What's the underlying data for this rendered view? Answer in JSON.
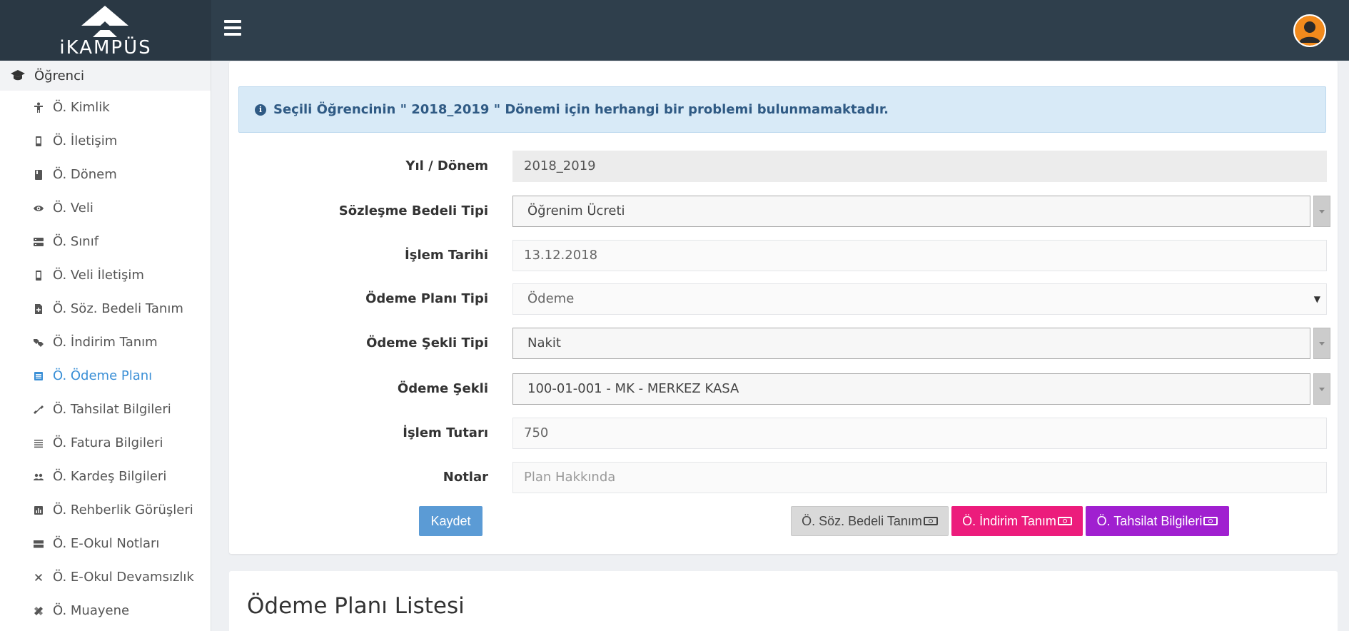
{
  "app": {
    "logo_text": "iKAMPÜS"
  },
  "sidebar": {
    "header": "Öğrenci",
    "items": [
      {
        "label": "Ö. Kimlik",
        "icon": "person-icon"
      },
      {
        "label": "Ö. İletişim",
        "icon": "phone-icon"
      },
      {
        "label": "Ö. Dönem",
        "icon": "book-icon"
      },
      {
        "label": "Ö. Veli",
        "icon": "eye-icon"
      },
      {
        "label": "Ö. Sınıf",
        "icon": "server-icon"
      },
      {
        "label": "Ö. Veli İletişim",
        "icon": "phone-icon"
      },
      {
        "label": "Ö. Söz. Bedeli Tanım",
        "icon": "file-plus-icon"
      },
      {
        "label": "Ö. İndirim Tanım",
        "icon": "tags-icon"
      },
      {
        "label": "Ö. Ödeme Planı",
        "icon": "list-alt-icon",
        "active": true
      },
      {
        "label": "Ö. Tahsilat Bilgileri",
        "icon": "link-icon"
      },
      {
        "label": "Ö. Fatura Bilgileri",
        "icon": "lines-icon"
      },
      {
        "label": "Ö. Kardeş Bilgileri",
        "icon": "people-icon"
      },
      {
        "label": "Ö. Rehberlik Görüşleri",
        "icon": "chart-icon"
      },
      {
        "label": "Ö. E-Okul Notları",
        "icon": "panels-icon"
      },
      {
        "label": "Ö. E-Okul Devamsızlık",
        "icon": "close-icon"
      },
      {
        "label": "Ö. Muayene",
        "icon": "bandage-icon"
      }
    ]
  },
  "alert": {
    "text": "Seçili Öğrencinin \" 2018_2019 \" Dönemi için herhangi bir problemi bulunmamaktadır."
  },
  "form": {
    "yil_donem": {
      "label": "Yıl / Dönem",
      "value": "2018_2019"
    },
    "sozlesme_bedeli_tipi": {
      "label": "Sözleşme Bedeli Tipi",
      "value": "Öğrenim Ücreti"
    },
    "islem_tarihi": {
      "label": "İşlem Tarihi",
      "value": "13.12.2018"
    },
    "odeme_plani_tipi": {
      "label": "Ödeme Planı Tipi",
      "value": "Ödeme"
    },
    "odeme_sekli_tipi": {
      "label": "Ödeme Şekli Tipi",
      "value": "Nakit"
    },
    "odeme_sekli": {
      "label": "Ödeme Şekli",
      "value": "100-01-001 - MK - MERKEZ KASA"
    },
    "islem_tutari": {
      "label": "İşlem Tutarı",
      "value": "750"
    },
    "notlar": {
      "label": "Notlar",
      "placeholder": "Plan Hakkında"
    }
  },
  "buttons": {
    "save": "Kaydet",
    "soz_bedeli": "Ö. Söz. Bedeli Tanım",
    "indirim": "Ö. İndirim Tanım",
    "tahsilat": "Ö. Tahsilat Bilgileri"
  },
  "colors": {
    "save": "#5b9bd5",
    "soz_bedeli": "#d9d9d9",
    "indirim": "#ec1c7c",
    "tahsilat": "#a020d0"
  },
  "list": {
    "title": "Ödeme Planı Listesi"
  }
}
